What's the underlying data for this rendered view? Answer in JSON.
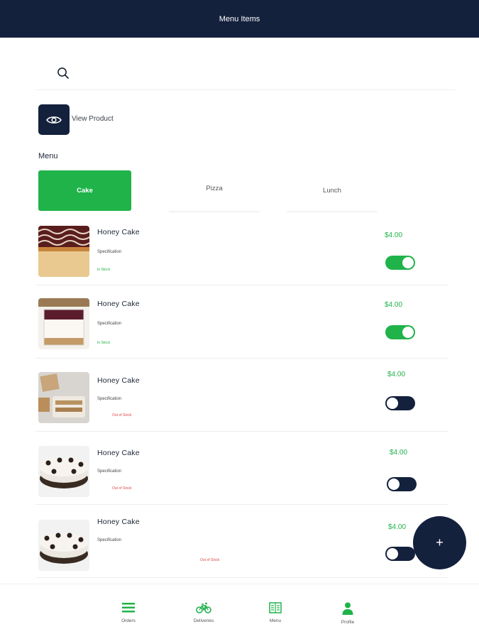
{
  "app_bar": {
    "title": "Menu Items"
  },
  "search": {
    "value": "",
    "placeholder": ""
  },
  "view_product": {
    "label": "View Product"
  },
  "menu": {
    "heading": "Menu",
    "categories": [
      {
        "label": "Cake",
        "active": true
      },
      {
        "label": "Pizza",
        "active": false
      },
      {
        "label": "Lunch",
        "active": false
      }
    ]
  },
  "items": [
    {
      "name": "Honey Cake",
      "spec": "Specification",
      "stock": "In Stock",
      "price": "$4.00",
      "available": true
    },
    {
      "name": "Honey Cake",
      "spec": "Specification",
      "stock": "In Stock",
      "price": "$4.00",
      "available": true
    },
    {
      "name": "Honey Cake",
      "spec": "Specification",
      "stock": "Out of Stock",
      "price": "$4.00",
      "available": false
    },
    {
      "name": "Honey Cake",
      "spec": "Specification",
      "stock": "Out of Stock",
      "price": "$4.00",
      "available": false
    },
    {
      "name": "Honey Cake",
      "spec": "Specification",
      "stock": "Out of Stock",
      "price": "$4.00",
      "available": false
    }
  ],
  "fab": {
    "label": "+"
  },
  "bottom_nav": [
    {
      "label": "Orders",
      "icon": "list-icon"
    },
    {
      "label": "Deliveries",
      "icon": "bicycle-icon"
    },
    {
      "label": "Menu",
      "icon": "menu-book-icon"
    },
    {
      "label": "Profile",
      "icon": "person-icon"
    }
  ],
  "colors": {
    "primary": "#14213d",
    "accent": "#1fb34a",
    "out_of_stock": "#e04848"
  }
}
